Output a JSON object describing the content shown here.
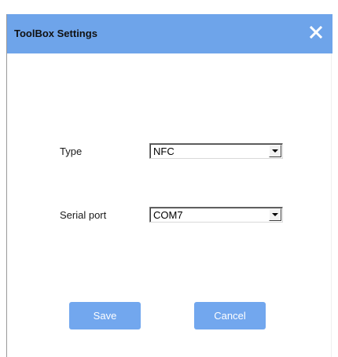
{
  "dialog": {
    "title": "ToolBox Settings",
    "close_icon": "close-icon",
    "accent_color": "#6ea4ea"
  },
  "form": {
    "type": {
      "label": "Type",
      "selected": "NFC"
    },
    "serial_port": {
      "label": "Serial port",
      "selected": "COM7"
    }
  },
  "actions": {
    "save_label": "Save",
    "cancel_label": "Cancel",
    "button_color": "#72a7ee"
  }
}
